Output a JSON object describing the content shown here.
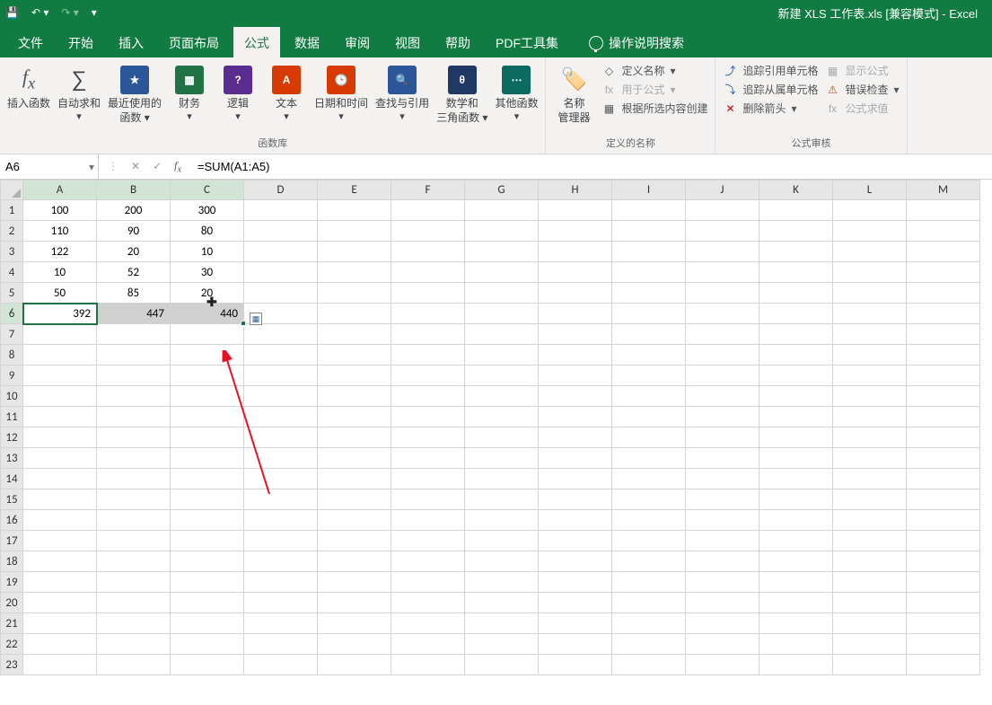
{
  "title": "新建 XLS 工作表.xls  [兼容模式]  -  Excel",
  "tabs": [
    "文件",
    "开始",
    "插入",
    "页面布局",
    "公式",
    "数据",
    "审阅",
    "视图",
    "帮助",
    "PDF工具集"
  ],
  "active_tab_index": 4,
  "tell_me": "操作说明搜索",
  "ribbon": {
    "group1": {
      "insert_fn_top": "插入函数",
      "autosum_top": "自动求和",
      "recent_top": "最近使用的",
      "recent_bottom": "函数",
      "financial": "财务",
      "logical": "逻辑",
      "text": "文本",
      "datetime": "日期和时间",
      "lookup": "查找与引用",
      "mathtrig_top": "数学和",
      "mathtrig_bottom": "三角函数",
      "other": "其他函数",
      "label": "函数库"
    },
    "group2": {
      "name_mgr_top": "名称",
      "name_mgr_bottom": "管理器",
      "define_name": "定义名称",
      "use_in_formula": "用于公式",
      "create_from_sel": "根据所选内容创建",
      "label": "定义的名称"
    },
    "group3": {
      "trace_prec": "追踪引用单元格",
      "trace_dep": "追踪从属单元格",
      "remove_arrows": "删除箭头",
      "show_formulas": "显示公式",
      "error_check": "错误检查",
      "eval_formula": "公式求值",
      "label": "公式审核"
    }
  },
  "namebox": "A6",
  "formula": "=SUM(A1:A5)",
  "columns": [
    "A",
    "B",
    "C",
    "D",
    "E",
    "F",
    "G",
    "H",
    "I",
    "J",
    "K",
    "L",
    "M"
  ],
  "rows": [
    "1",
    "2",
    "3",
    "4",
    "5",
    "6",
    "7",
    "8",
    "9",
    "10",
    "11",
    "12",
    "13",
    "14",
    "15",
    "16",
    "17",
    "18",
    "19",
    "20",
    "21",
    "22",
    "23"
  ],
  "data": {
    "r1": {
      "a": "100",
      "b": "200",
      "c": "300"
    },
    "r2": {
      "a": "110",
      "b": "90",
      "c": "80"
    },
    "r3": {
      "a": "122",
      "b": "20",
      "c": "10"
    },
    "r4": {
      "a": "10",
      "b": "52",
      "c": "30"
    },
    "r5": {
      "a": "50",
      "b": "85",
      "c": "20"
    },
    "r6": {
      "a": "392",
      "b": "447",
      "c": "440"
    }
  }
}
